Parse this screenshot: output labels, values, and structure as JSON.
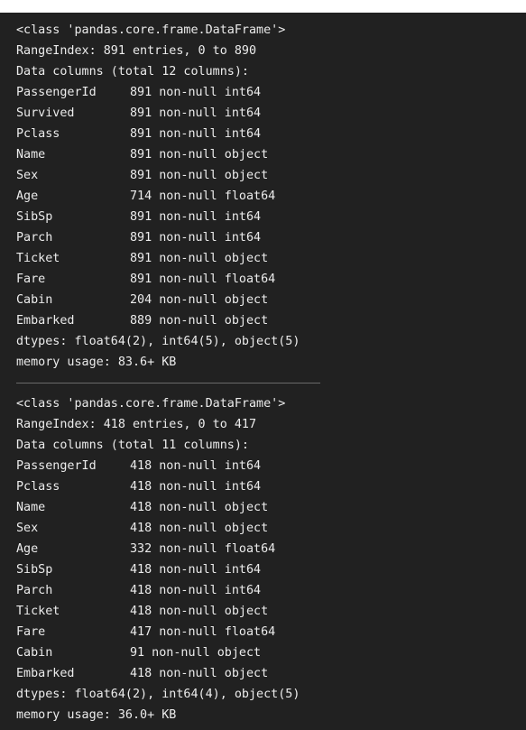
{
  "blocks": [
    {
      "class_line": "<class 'pandas.core.frame.DataFrame'>",
      "range_index": "RangeIndex: 891 entries, 0 to 890",
      "data_columns": "Data columns (total 12 columns):",
      "columns": [
        {
          "name": "PassengerId",
          "info": "891 non-null int64"
        },
        {
          "name": "Survived",
          "info": "891 non-null int64"
        },
        {
          "name": "Pclass",
          "info": "891 non-null int64"
        },
        {
          "name": "Name",
          "info": "891 non-null object"
        },
        {
          "name": "Sex",
          "info": "891 non-null object"
        },
        {
          "name": "Age",
          "info": "714 non-null float64"
        },
        {
          "name": "SibSp",
          "info": "891 non-null int64"
        },
        {
          "name": "Parch",
          "info": "891 non-null int64"
        },
        {
          "name": "Ticket",
          "info": "891 non-null object"
        },
        {
          "name": "Fare",
          "info": "891 non-null float64"
        },
        {
          "name": "Cabin",
          "info": "204 non-null object"
        },
        {
          "name": "Embarked",
          "info": "889 non-null object"
        }
      ],
      "dtypes": "dtypes: float64(2), int64(5), object(5)",
      "memory": "memory usage: 83.6+ KB"
    },
    {
      "class_line": "<class 'pandas.core.frame.DataFrame'>",
      "range_index": "RangeIndex: 418 entries, 0 to 417",
      "data_columns": "Data columns (total 11 columns):",
      "columns": [
        {
          "name": "PassengerId",
          "info": "418 non-null int64"
        },
        {
          "name": "Pclass",
          "info": "418 non-null int64"
        },
        {
          "name": "Name",
          "info": "418 non-null object"
        },
        {
          "name": "Sex",
          "info": "418 non-null object"
        },
        {
          "name": "Age",
          "info": "332 non-null float64"
        },
        {
          "name": "SibSp",
          "info": "418 non-null int64"
        },
        {
          "name": "Parch",
          "info": "418 non-null int64"
        },
        {
          "name": "Ticket",
          "info": "418 non-null object"
        },
        {
          "name": "Fare",
          "info": "417 non-null float64"
        },
        {
          "name": "Cabin",
          "info": "91 non-null object"
        },
        {
          "name": "Embarked",
          "info": "418 non-null object"
        }
      ],
      "dtypes": "dtypes: float64(2), int64(4), object(5)",
      "memory": "memory usage: 36.0+ KB"
    }
  ]
}
